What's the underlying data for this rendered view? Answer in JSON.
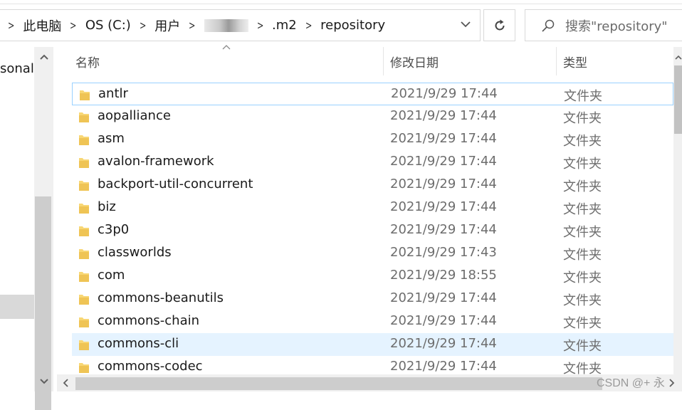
{
  "breadcrumb": {
    "items": [
      {
        "label": "此电脑"
      },
      {
        "label": "OS (C:)"
      },
      {
        "label": "用户"
      },
      {
        "label": ""
      },
      {
        "label": ".m2"
      },
      {
        "label": "repository"
      }
    ]
  },
  "search": {
    "placeholder": "搜索\"repository\""
  },
  "nav": {
    "visible_label": "sonal"
  },
  "columns": {
    "name": "名称",
    "date": "修改日期",
    "type": "类型"
  },
  "files": [
    {
      "name": "antlr",
      "date": "2021/9/29 17:44",
      "type": "文件夹",
      "state": "focused"
    },
    {
      "name": "aopalliance",
      "date": "2021/9/29 17:44",
      "type": "文件夹"
    },
    {
      "name": "asm",
      "date": "2021/9/29 17:44",
      "type": "文件夹"
    },
    {
      "name": "avalon-framework",
      "date": "2021/9/29 17:44",
      "type": "文件夹"
    },
    {
      "name": "backport-util-concurrent",
      "date": "2021/9/29 17:44",
      "type": "文件夹"
    },
    {
      "name": "biz",
      "date": "2021/9/29 17:44",
      "type": "文件夹"
    },
    {
      "name": "c3p0",
      "date": "2021/9/29 17:44",
      "type": "文件夹"
    },
    {
      "name": "classworlds",
      "date": "2021/9/29 17:43",
      "type": "文件夹"
    },
    {
      "name": "com",
      "date": "2021/9/29 18:55",
      "type": "文件夹"
    },
    {
      "name": "commons-beanutils",
      "date": "2021/9/29 17:44",
      "type": "文件夹"
    },
    {
      "name": "commons-chain",
      "date": "2021/9/29 17:44",
      "type": "文件夹"
    },
    {
      "name": "commons-cli",
      "date": "2021/9/29 17:44",
      "type": "文件夹",
      "state": "hover"
    },
    {
      "name": "commons-codec",
      "date": "2021/9/29 17:44",
      "type": "文件夹"
    }
  ],
  "watermark": "CSDN @+ 永",
  "colors": {
    "selection_border": "#99d1ff",
    "hover_bg": "#e5f3ff",
    "folder": "#f8d775"
  },
  "icons": [
    "chevron-right-icon",
    "chevron-down-icon",
    "refresh-icon",
    "search-icon",
    "folder-icon",
    "sort-up-icon"
  ]
}
